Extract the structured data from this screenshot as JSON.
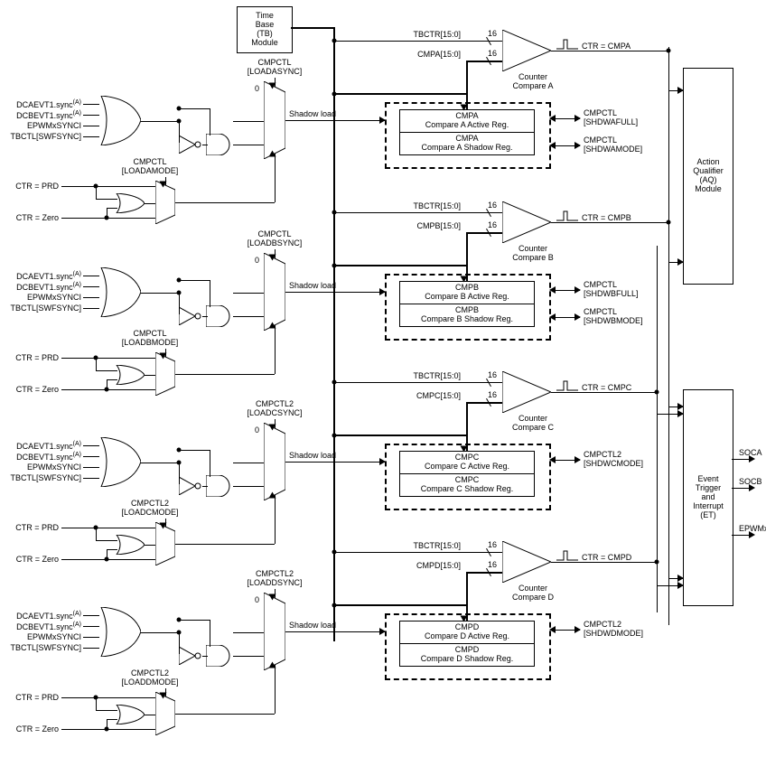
{
  "time_base_module": [
    "Time",
    "Base",
    "(TB)",
    "Module"
  ],
  "aq_module": [
    "Action",
    "Qualifier",
    "(AQ)",
    "Module"
  ],
  "et_module": [
    "Event",
    "Trigger",
    "and",
    "Interrupt",
    "(ET)"
  ],
  "et_outputs": [
    "SOCA",
    "SOCB",
    "EPWMxINT"
  ],
  "shadow_load_label": "Shadow load",
  "mux_zero_label": "0",
  "ctr_labels": {
    "prd": "CTR = PRD",
    "zero": "CTR = Zero"
  },
  "sync_sources": [
    "DCAEVT1.sync",
    "DCBEVT1.sync",
    "EPWMxSYNCI",
    "TBCTL[SWFSYNC]"
  ],
  "channels": [
    {
      "letter": "A",
      "tbctr": "TBCTR[15:0]",
      "cmp_bus": "CMPA[15:0]",
      "bus_width": "16",
      "compare_name": [
        "Counter",
        "Compare A"
      ],
      "ctr_eq": "CTR = CMPA",
      "reg_active": [
        "CMPA",
        "Compare A Active Reg."
      ],
      "reg_shadow": [
        "CMPA",
        "Compare A Shadow Reg."
      ],
      "loadsync": [
        "CMPCTL",
        "[LOADASYNC]"
      ],
      "loadmode": [
        "CMPCTL",
        "[LOADAMODE]"
      ],
      "side_ctl": [
        "CMPCTL [SHDWAFULL]",
        "CMPCTL [SHDWAMODE]"
      ]
    },
    {
      "letter": "B",
      "tbctr": "TBCTR[15:0]",
      "cmp_bus": "CMPB[15:0]",
      "bus_width": "16",
      "compare_name": [
        "Counter",
        "Compare B"
      ],
      "ctr_eq": "CTR = CMPB",
      "reg_active": [
        "CMPB",
        "Compare B Active Reg."
      ],
      "reg_shadow": [
        "CMPB",
        "Compare B Shadow Reg."
      ],
      "loadsync": [
        "CMPCTL",
        "[LOADBSYNC]"
      ],
      "loadmode": [
        "CMPCTL",
        "[LOADBMODE]"
      ],
      "side_ctl": [
        "CMPCTL [SHDWBFULL]",
        "CMPCTL [SHDWBMODE]"
      ]
    },
    {
      "letter": "C",
      "tbctr": "TBCTR[15:0]",
      "cmp_bus": "CMPC[15:0]",
      "bus_width": "16",
      "compare_name": [
        "Counter",
        "Compare C"
      ],
      "ctr_eq": "CTR = CMPC",
      "reg_active": [
        "CMPC",
        "Compare C Active Reg."
      ],
      "reg_shadow": [
        "CMPC",
        "Compare C Shadow Reg."
      ],
      "loadsync": [
        "CMPCTL2",
        "[LOADCSYNC]"
      ],
      "loadmode": [
        "CMPCTL2",
        "[LOADCMODE]"
      ],
      "side_ctl": [
        "CMPCTL2 [SHDWCMODE]"
      ]
    },
    {
      "letter": "D",
      "tbctr": "TBCTR[15:0]",
      "cmp_bus": "CMPD[15:0]",
      "bus_width": "16",
      "compare_name": [
        "Counter",
        "Compare D"
      ],
      "ctr_eq": "CTR = CMPD",
      "reg_active": [
        "CMPD",
        "Compare D Active Reg."
      ],
      "reg_shadow": [
        "CMPD",
        "Compare D Shadow Reg."
      ],
      "loadsync": [
        "CMPCTL2",
        "[LOADDSYNC]"
      ],
      "loadmode": [
        "CMPCTL2",
        "[LOADDMODE]"
      ],
      "side_ctl": [
        "CMPCTL2 [SHDWDMODE]"
      ]
    }
  ]
}
